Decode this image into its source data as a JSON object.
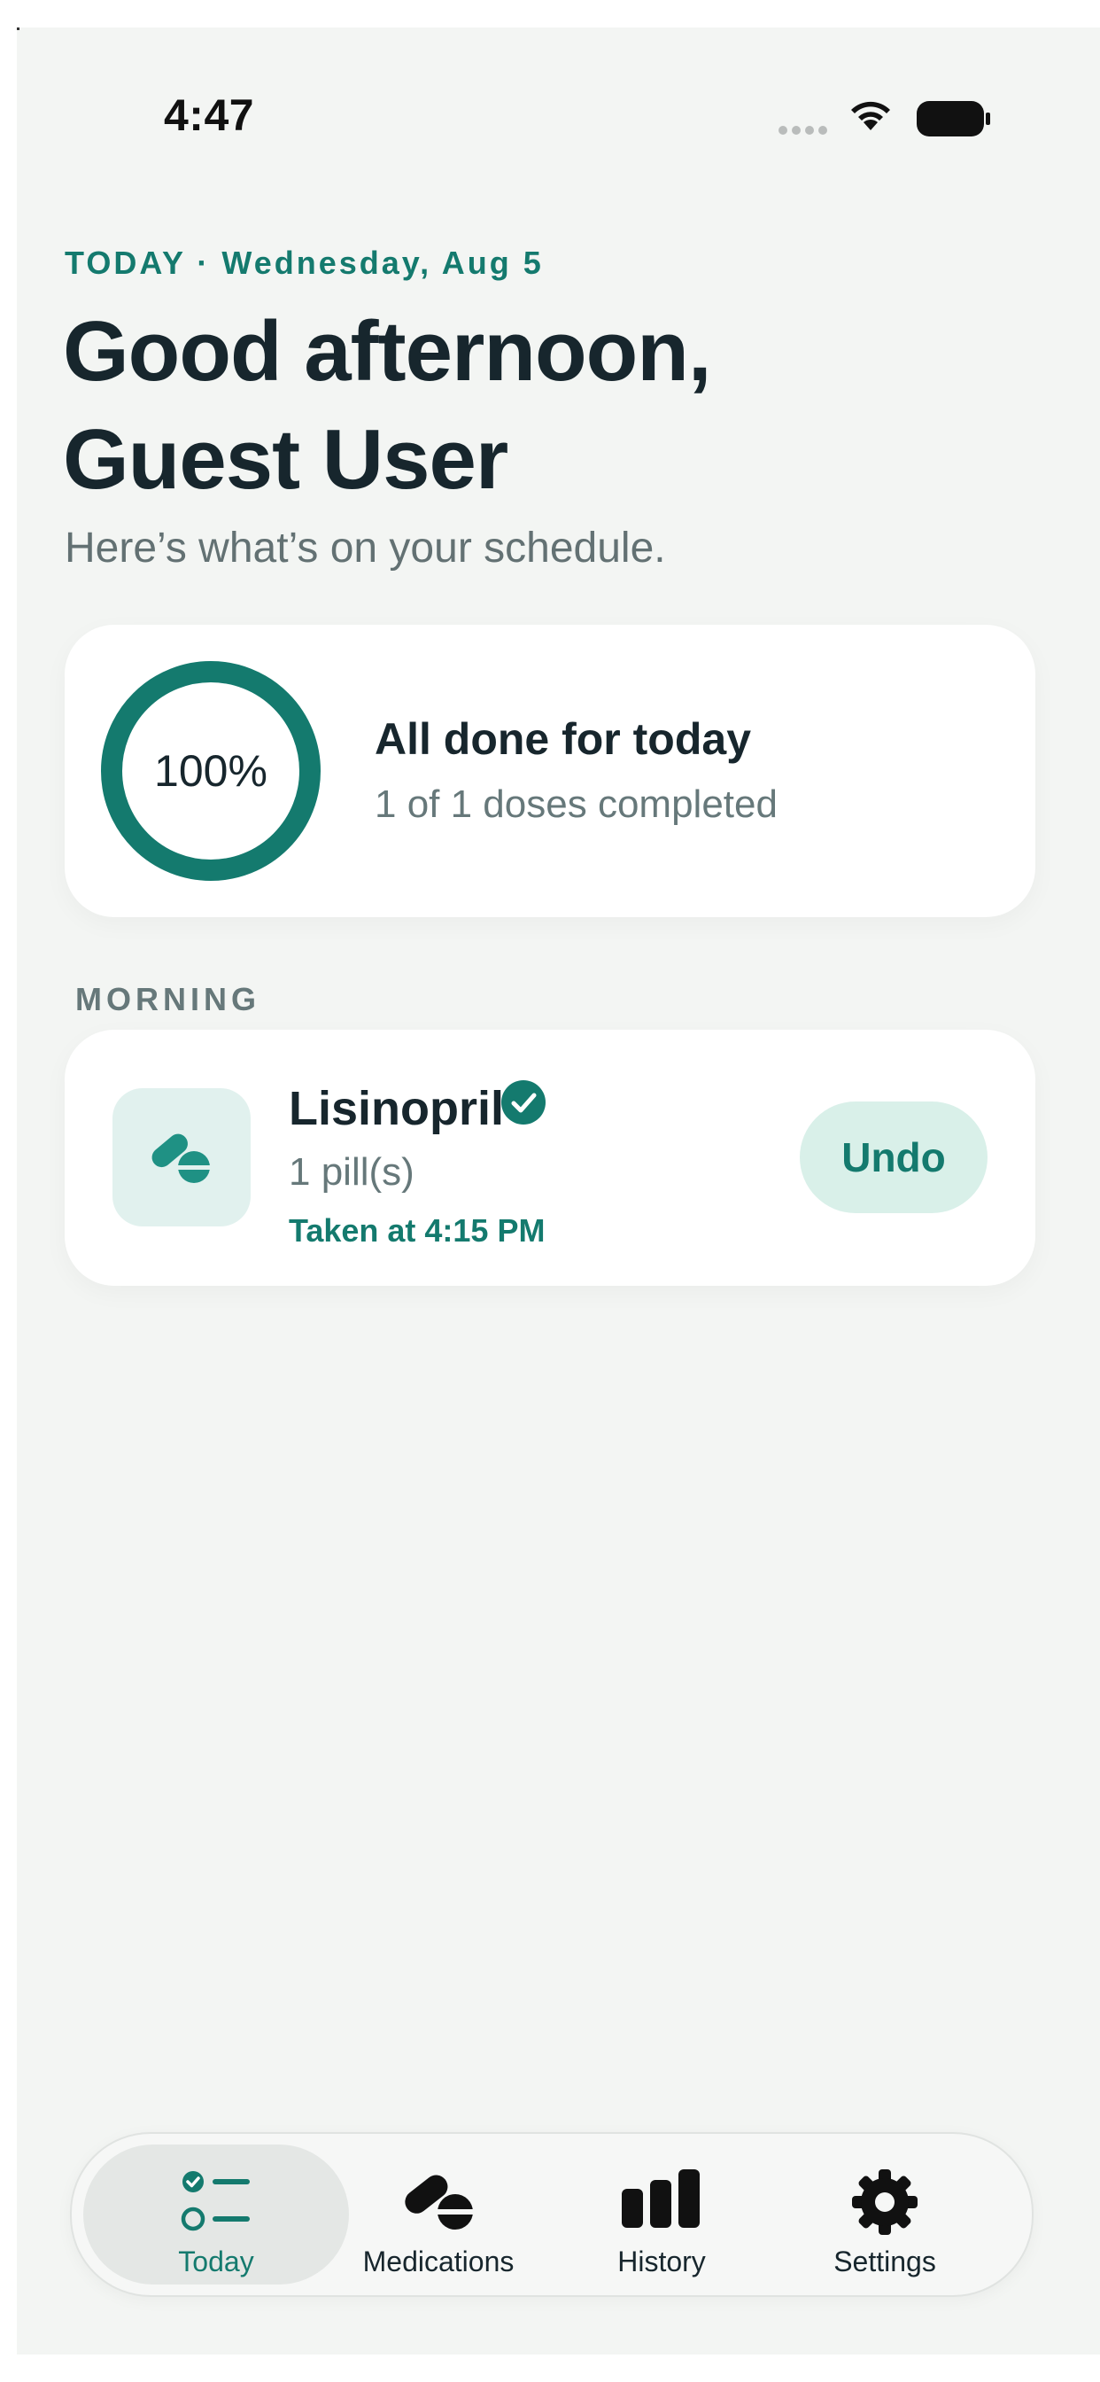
{
  "status_bar": {
    "time": "4:47"
  },
  "header": {
    "eyebrow": "TODAY · Wednesday, Aug 5",
    "greeting_line1": "Good afternoon,",
    "greeting_line2": "Guest User",
    "subtitle": "Here’s what’s on your schedule."
  },
  "summary": {
    "progress_percent": 100,
    "progress_label": "100%",
    "title": "All done for today",
    "subtitle": "1 of 1 doses completed"
  },
  "sections": [
    {
      "label": "MORNING",
      "items": [
        {
          "name": "Lisinopril",
          "dose": "1 pill(s)",
          "status": "Taken at 4:15 PM",
          "action_label": "Undo",
          "icon": "pill-icon",
          "taken": true
        }
      ]
    }
  ],
  "tab_bar": {
    "active": "Today",
    "tabs": [
      {
        "label": "Today",
        "icon": "checklist-icon"
      },
      {
        "label": "Medications",
        "icon": "pill-icon"
      },
      {
        "label": "History",
        "icon": "bar-chart-icon"
      },
      {
        "label": "Settings",
        "icon": "gear-icon"
      }
    ]
  },
  "colors": {
    "accent": "#147a6e",
    "background": "#f3f5f3",
    "card": "#ffffff",
    "text_primary": "#17262d",
    "text_secondary": "#66787a"
  }
}
